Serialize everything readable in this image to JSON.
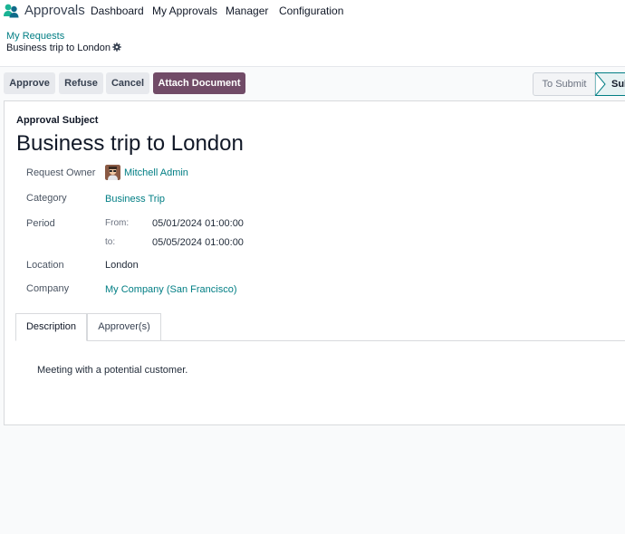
{
  "nav": {
    "app_name": "Approvals",
    "menu": [
      "Dashboard",
      "My Approvals",
      "Manager",
      "Configuration"
    ]
  },
  "breadcrumb": {
    "parent": "My Requests",
    "current": "Business trip to London"
  },
  "actions": {
    "approve": "Approve",
    "refuse": "Refuse",
    "cancel": "Cancel",
    "attach": "Attach Document"
  },
  "status": {
    "stages": [
      "To Submit",
      "Sub"
    ],
    "active": "Sub"
  },
  "form": {
    "subject_label": "Approval Subject",
    "subject": "Business trip to London",
    "fields": {
      "owner_label": "Request Owner",
      "owner": "Mitchell Admin",
      "category_label": "Category",
      "category": "Business Trip",
      "period_label": "Period",
      "from_label": "From:",
      "from": "05/01/2024 01:00:00",
      "to_label": "to:",
      "to": "05/05/2024 01:00:00",
      "location_label": "Location",
      "location": "London",
      "company_label": "Company",
      "company": "My Company (San Francisco)"
    },
    "tabs": [
      "Description",
      "Approver(s)"
    ],
    "active_tab": "Description",
    "description": "Meeting with a potential customer."
  },
  "colors": {
    "accent": "#714b67",
    "link": "#017e84"
  }
}
